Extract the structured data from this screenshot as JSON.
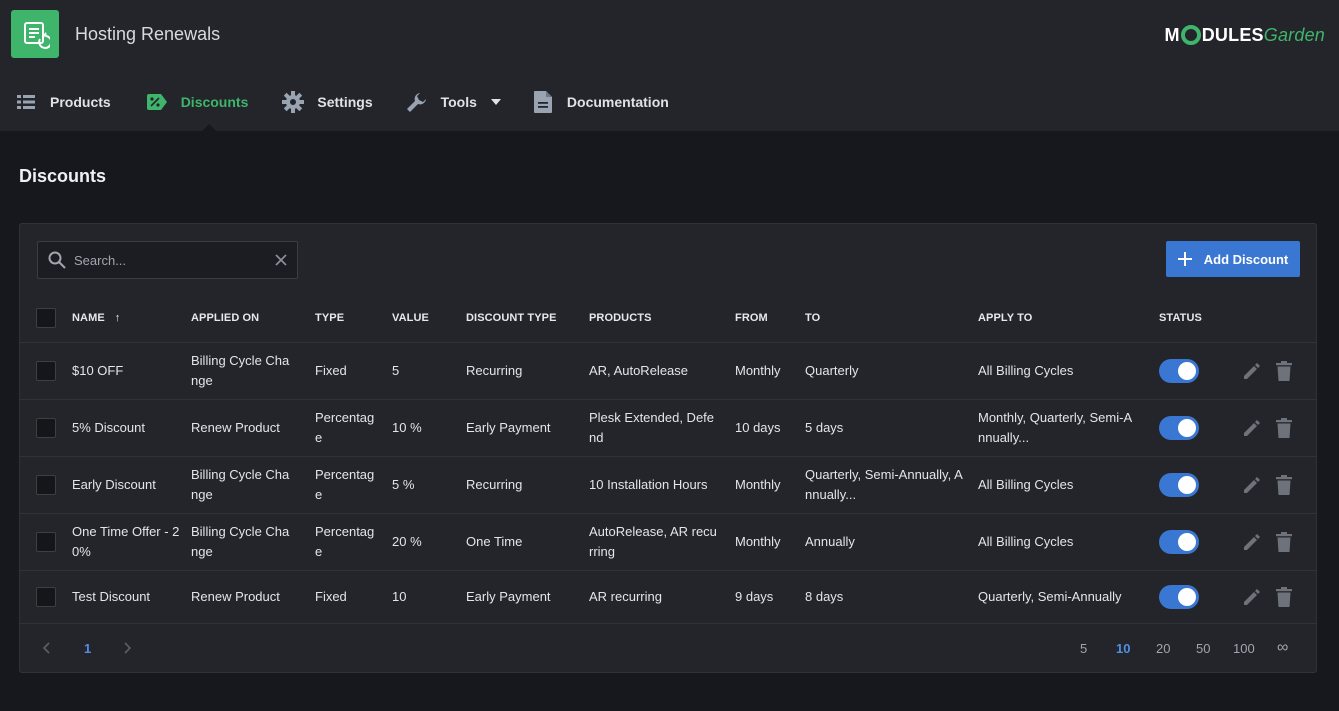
{
  "app": {
    "title": "Hosting Renewals"
  },
  "brand": {
    "part_a": "M",
    "part_b": "DULES",
    "part_c": "Garden"
  },
  "nav": {
    "items": [
      {
        "label": "Products",
        "icon": "list-icon"
      },
      {
        "label": "Discounts",
        "icon": "discount-tag-icon",
        "active": true
      },
      {
        "label": "Settings",
        "icon": "gear-icon"
      },
      {
        "label": "Tools",
        "icon": "wrench-icon"
      },
      {
        "label": "Documentation",
        "icon": "document-icon"
      }
    ]
  },
  "page": {
    "title": "Discounts"
  },
  "search": {
    "placeholder": "Search..."
  },
  "toolbar": {
    "add_label": "Add Discount"
  },
  "table": {
    "columns": [
      "NAME",
      "APPLIED ON",
      "TYPE",
      "VALUE",
      "DISCOUNT TYPE",
      "PRODUCTS",
      "FROM",
      "TO",
      "APPLY TO",
      "STATUS"
    ],
    "sort_indicator": "↑",
    "rows": [
      {
        "name": "$10 OFF",
        "applied_on": "Billing Cycle Change",
        "type": "Fixed",
        "value": "5",
        "discount_type": "Recurring",
        "products": "AR, AutoRelease",
        "from": "Monthly",
        "to": "Quarterly",
        "apply_to": "All Billing Cycles",
        "status": true
      },
      {
        "name": "5% Discount",
        "applied_on": "Renew Product",
        "type": "Percentage",
        "value": "10 %",
        "discount_type": "Early Payment",
        "products": "Plesk Extended, Defend",
        "from": "10 days",
        "to": "5 days",
        "apply_to": "Monthly, Quarterly, Semi-Annually...",
        "status": true
      },
      {
        "name": "Early Discount",
        "applied_on": "Billing Cycle Change",
        "type": "Percentage",
        "value": "5 %",
        "discount_type": "Recurring",
        "products": "10 Installation Hours",
        "from": "Monthly",
        "to": "Quarterly, Semi-Annually, Annually...",
        "apply_to": "All Billing Cycles",
        "status": true
      },
      {
        "name": "One Time Offer - 20%",
        "applied_on": "Billing Cycle Change",
        "type": "Percentage",
        "value": "20 %",
        "discount_type": "One Time",
        "products": "AutoRelease, AR recurring",
        "from": "Monthly",
        "to": "Annually",
        "apply_to": "All Billing Cycles",
        "status": true
      },
      {
        "name": "Test Discount",
        "applied_on": "Renew Product",
        "type": "Fixed",
        "value": "10",
        "discount_type": "Early Payment",
        "products": "AR recurring",
        "from": "9 days",
        "to": "8 days",
        "apply_to": "Quarterly, Semi-Annually",
        "status": true
      }
    ]
  },
  "pagination": {
    "current_page": "1",
    "page_sizes": [
      "5",
      "10",
      "20",
      "50",
      "100",
      "∞"
    ],
    "selected_size": "10"
  },
  "colors": {
    "accent_green": "#3fb56b",
    "accent_blue": "#3a77d3",
    "background": "#17181d",
    "panel": "#23252b"
  }
}
